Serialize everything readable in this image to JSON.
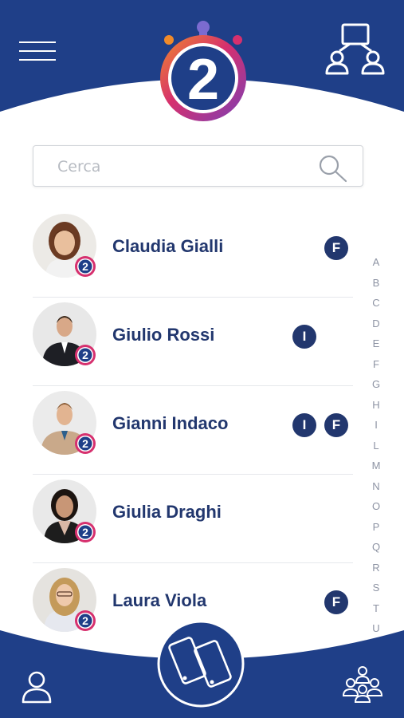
{
  "header": {
    "logo_text": "2",
    "menu_icon": "hamburger-menu-icon",
    "top_right_icon": "org-chart-icon"
  },
  "search": {
    "placeholder": "Cerca",
    "icon": "search-icon"
  },
  "contacts": [
    {
      "name": "Claudia Gialli",
      "badges": [
        "F"
      ]
    },
    {
      "name": "Giulio Rossi",
      "badges": [
        "I"
      ]
    },
    {
      "name": "Gianni Indaco",
      "badges": [
        "I",
        "F"
      ]
    },
    {
      "name": "Giulia Draghi",
      "badges": []
    },
    {
      "name": "Laura Viola",
      "badges": [
        "F"
      ]
    }
  ],
  "alphabet": [
    "A",
    "B",
    "C",
    "D",
    "E",
    "F",
    "G",
    "H",
    "I",
    "L",
    "M",
    "N",
    "O",
    "P",
    "Q",
    "R",
    "S",
    "T",
    "U"
  ],
  "bottom_nav": {
    "left_icon": "user-icon",
    "center_icon": "two-phones-icon",
    "right_icon": "group-icon"
  },
  "colors": {
    "navy": "#22376e",
    "primary_blue": "#1f3f88",
    "logo_orange": "#f08a2a",
    "logo_magenta": "#d6306e",
    "logo_purple": "#7b3fb5",
    "text_gray": "#8d93a3"
  }
}
